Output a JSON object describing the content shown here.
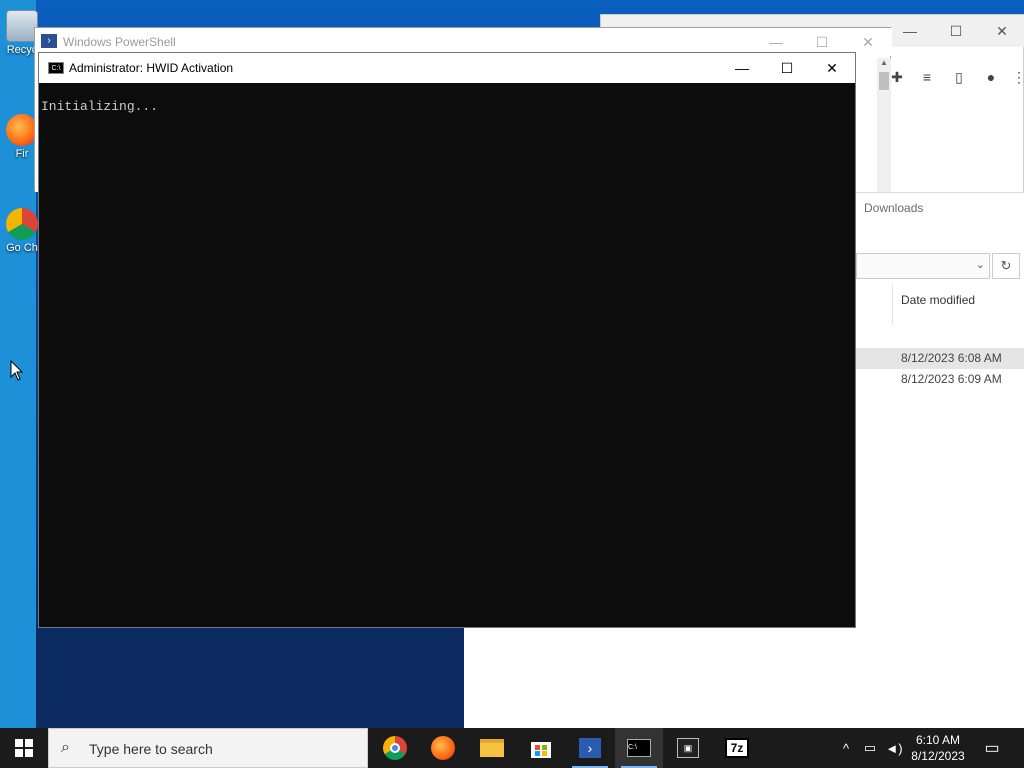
{
  "desktop": {
    "icons": [
      {
        "label": "Recyc",
        "icon": "recycle-bin"
      },
      {
        "label": "Fir",
        "icon": "firefox"
      },
      {
        "label": "Go Ch",
        "icon": "chrome"
      }
    ]
  },
  "browser": {
    "toolbar_icons": [
      "extensions-icon",
      "reading-list-icon",
      "sidebar-icon",
      "profile-icon",
      "menu-icon"
    ]
  },
  "explorer": {
    "breadcrumb": "Downloads",
    "column_date": "Date modified",
    "rows": [
      {
        "date": "8/12/2023 6:08 AM"
      },
      {
        "date": "8/12/2023 6:09 AM"
      }
    ]
  },
  "powershell": {
    "title": "Windows PowerShell"
  },
  "cmd": {
    "title": "Administrator:  HWID Activation",
    "output": "Initializing..."
  },
  "taskbar": {
    "search_placeholder": "Type here to search",
    "apps": [
      "chrome",
      "firefox",
      "file-explorer",
      "microsoft-store",
      "powershell",
      "command-prompt",
      "terminal",
      "7zip"
    ],
    "clock_time": "6:10 AM",
    "clock_date": "8/12/2023"
  },
  "colors": {
    "desktop_accent": "#1e90d8",
    "console_bg": "#0c0c0c",
    "console_text": "#cccccc",
    "taskbar_bg": "#1b1b1b"
  }
}
